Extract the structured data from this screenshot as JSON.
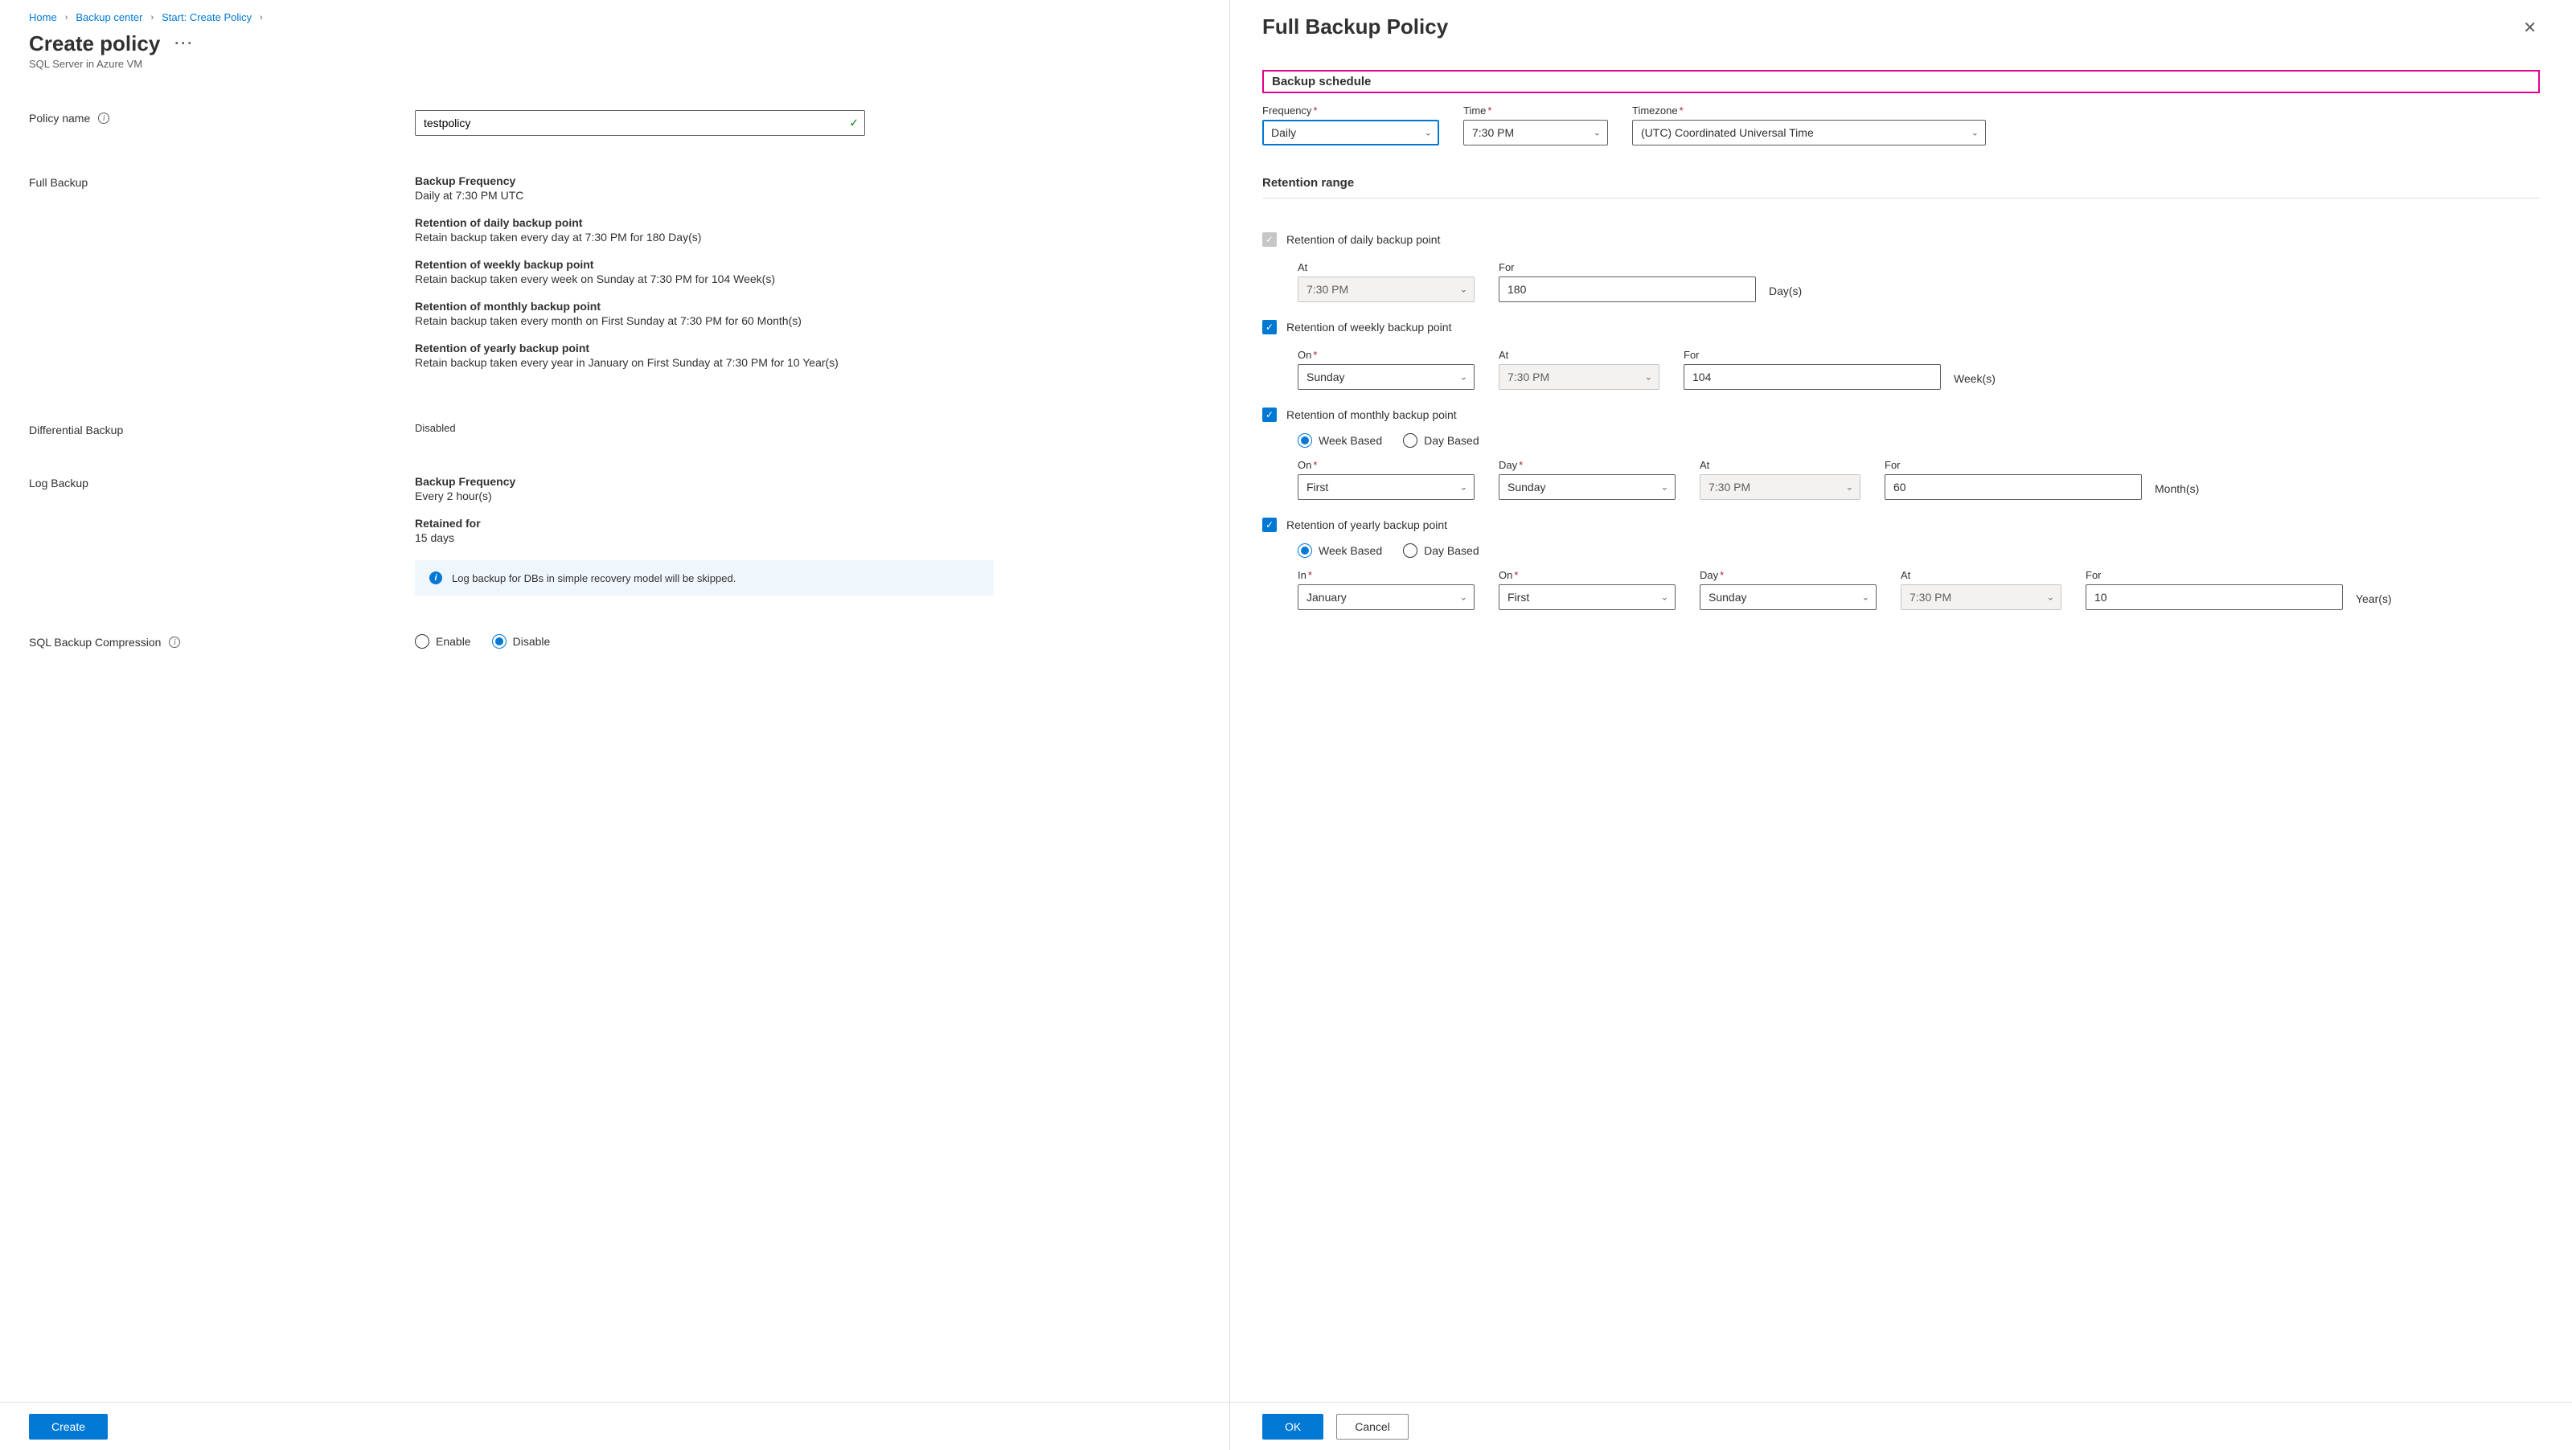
{
  "breadcrumb": {
    "home": "Home",
    "backup_center": "Backup center",
    "start": "Start: Create Policy"
  },
  "left": {
    "title": "Create policy",
    "subtitle": "SQL Server in Azure VM",
    "policy_name_label": "Policy name",
    "policy_name_value": "testpolicy",
    "full_backup_label": "Full Backup",
    "fb": {
      "freq_title": "Backup Frequency",
      "freq_detail": "Daily at 7:30 PM UTC",
      "daily_title": "Retention of daily backup point",
      "daily_detail": "Retain backup taken every day at 7:30 PM for 180 Day(s)",
      "weekly_title": "Retention of weekly backup point",
      "weekly_detail": "Retain backup taken every week on Sunday at 7:30 PM for 104 Week(s)",
      "monthly_title": "Retention of monthly backup point",
      "monthly_detail": "Retain backup taken every month on First Sunday at 7:30 PM for 60 Month(s)",
      "yearly_title": "Retention of yearly backup point",
      "yearly_detail": "Retain backup taken every year in January on First Sunday at 7:30 PM for 10 Year(s)"
    },
    "diff_label": "Differential Backup",
    "diff_value": "Disabled",
    "log_label": "Log Backup",
    "log": {
      "freq_title": "Backup Frequency",
      "freq_detail": "Every 2 hour(s)",
      "ret_title": "Retained for",
      "ret_detail": "15 days"
    },
    "banner": "Log backup for DBs in simple recovery model will be skipped.",
    "compression_label": "SQL Backup Compression",
    "radio_enable": "Enable",
    "radio_disable": "Disable",
    "create_btn": "Create"
  },
  "right": {
    "title": "Full Backup Policy",
    "schedule_heading": "Backup schedule",
    "freq_label": "Frequency",
    "freq_value": "Daily",
    "time_label": "Time",
    "time_value": "7:30 PM",
    "tz_label": "Timezone",
    "tz_value": "(UTC) Coordinated Universal Time",
    "retention_heading": "Retention range",
    "daily": {
      "label": "Retention of daily backup point",
      "at_label": "At",
      "at_value": "7:30 PM",
      "for_label": "For",
      "for_value": "180",
      "unit": "Day(s)"
    },
    "weekly": {
      "label": "Retention of weekly backup point",
      "on_label": "On",
      "on_value": "Sunday",
      "at_label": "At",
      "at_value": "7:30 PM",
      "for_label": "For",
      "for_value": "104",
      "unit": "Week(s)"
    },
    "monthly": {
      "label": "Retention of monthly backup point",
      "week_based": "Week Based",
      "day_based": "Day Based",
      "on_label": "On",
      "on_value": "First",
      "day_label": "Day",
      "day_value": "Sunday",
      "at_label": "At",
      "at_value": "7:30 PM",
      "for_label": "For",
      "for_value": "60",
      "unit": "Month(s)"
    },
    "yearly": {
      "label": "Retention of yearly backup point",
      "week_based": "Week Based",
      "day_based": "Day Based",
      "in_label": "In",
      "in_value": "January",
      "on_label": "On",
      "on_value": "First",
      "day_label": "Day",
      "day_value": "Sunday",
      "at_label": "At",
      "at_value": "7:30 PM",
      "for_label": "For",
      "for_value": "10",
      "unit": "Year(s)"
    },
    "ok_btn": "OK",
    "cancel_btn": "Cancel"
  }
}
